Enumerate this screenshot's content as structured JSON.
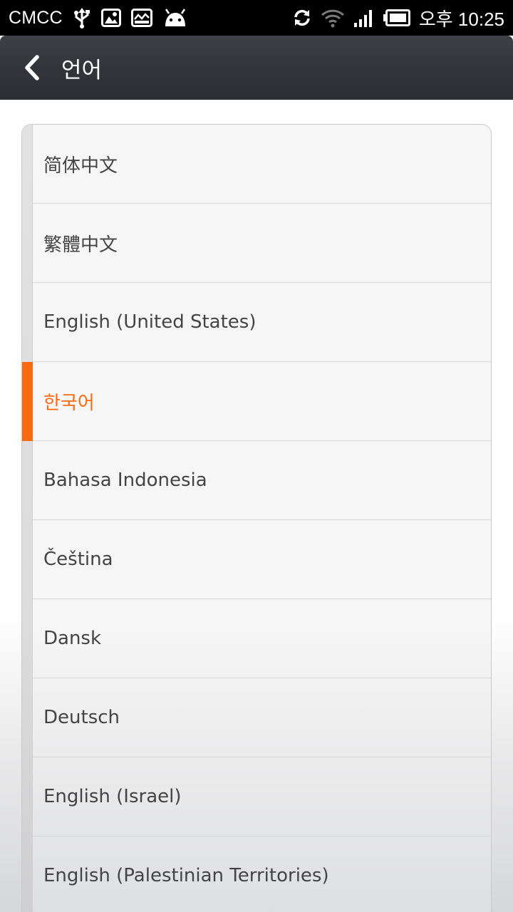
{
  "status_bar": {
    "carrier": "CMCC",
    "time": "오후 10:25",
    "icons_left": [
      "usb-icon",
      "image-icon",
      "screenshot-icon",
      "android-icon"
    ],
    "icons_right": [
      "sync-icon",
      "wifi-icon",
      "signal-icon",
      "battery-icon"
    ]
  },
  "header": {
    "back_icon": "chevron-left-icon",
    "title": "언어"
  },
  "accent_color": "#fc6a0f",
  "languages": [
    {
      "label": "简体中文",
      "selected": false
    },
    {
      "label": "繁體中文",
      "selected": false
    },
    {
      "label": "English (United States)",
      "selected": false
    },
    {
      "label": "한국어",
      "selected": true
    },
    {
      "label": "Bahasa Indonesia",
      "selected": false
    },
    {
      "label": "Čeština",
      "selected": false
    },
    {
      "label": "Dansk",
      "selected": false
    },
    {
      "label": "Deutsch",
      "selected": false
    },
    {
      "label": "English (Israel)",
      "selected": false
    },
    {
      "label": "English (Palestinian Territories)",
      "selected": false
    }
  ]
}
